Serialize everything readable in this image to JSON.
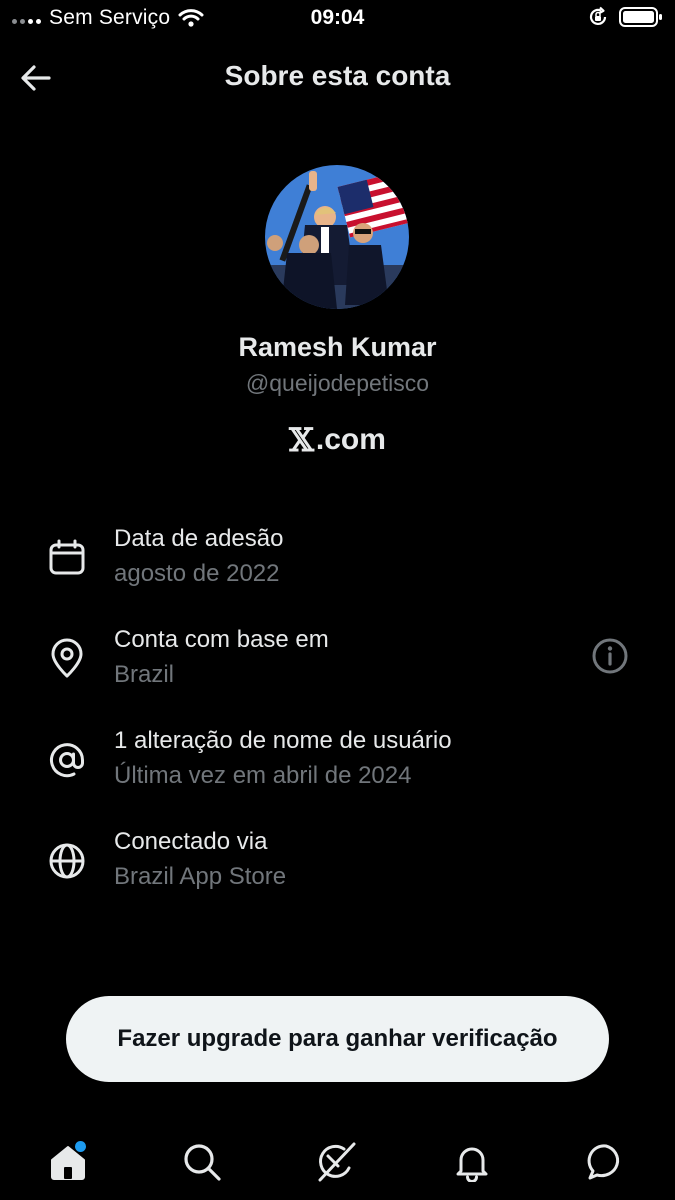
{
  "status_bar": {
    "carrier": "Sem Serviço",
    "time": "09:04"
  },
  "header": {
    "title": "Sobre esta conta"
  },
  "profile": {
    "name": "Ramesh Kumar",
    "handle": "@queijodepetisco",
    "site_mark": "𝕏",
    "site_suffix": ".com"
  },
  "info": [
    {
      "icon": "calendar-icon",
      "title": "Data de adesão",
      "subtitle": "agosto de 2022"
    },
    {
      "icon": "location-pin-icon",
      "title": "Conta com base em",
      "subtitle": "Brazil",
      "action_icon": "info-circle-icon"
    },
    {
      "icon": "at-sign-icon",
      "title": "1 alteração de nome de usuário",
      "subtitle": "Última vez em abril de 2024"
    },
    {
      "icon": "globe-icon",
      "title": "Conectado via",
      "subtitle": "Brazil App Store"
    }
  ],
  "upgrade_button": {
    "label": "Fazer upgrade para ganhar verificação"
  },
  "tabbar": {
    "items": [
      "home-icon",
      "search-icon",
      "grok-icon",
      "bell-icon",
      "messages-icon"
    ],
    "home_has_new": true
  },
  "colors": {
    "background": "#000000",
    "primary_text": "#e7e9ea",
    "secondary_text": "#71767b",
    "accent": "#1d9bf0",
    "pill_bg": "#eff3f4"
  }
}
